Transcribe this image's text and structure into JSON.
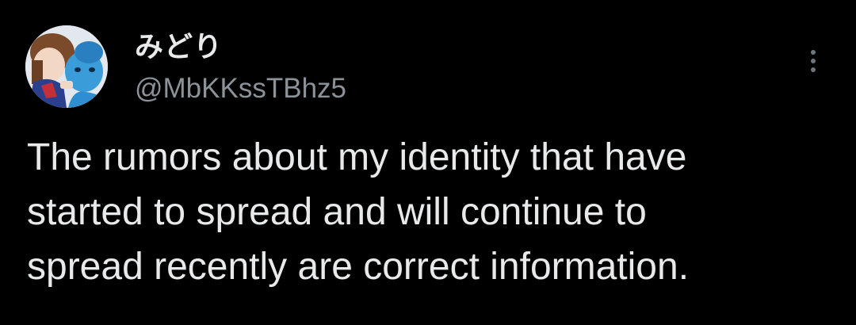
{
  "user": {
    "display_name": "みどり",
    "handle": "@MbKKssTBhz5",
    "avatar_icon": "user-avatar"
  },
  "actions": {
    "more_icon": "more-vertical-icon"
  },
  "tweet": {
    "lines": [
      "The rumors about my identity that have",
      "started to spread and will continue to",
      "spread recently are correct information."
    ]
  },
  "colors": {
    "background": "#000000",
    "text": "#e7e9ea",
    "secondary_text": "#8b9299"
  }
}
